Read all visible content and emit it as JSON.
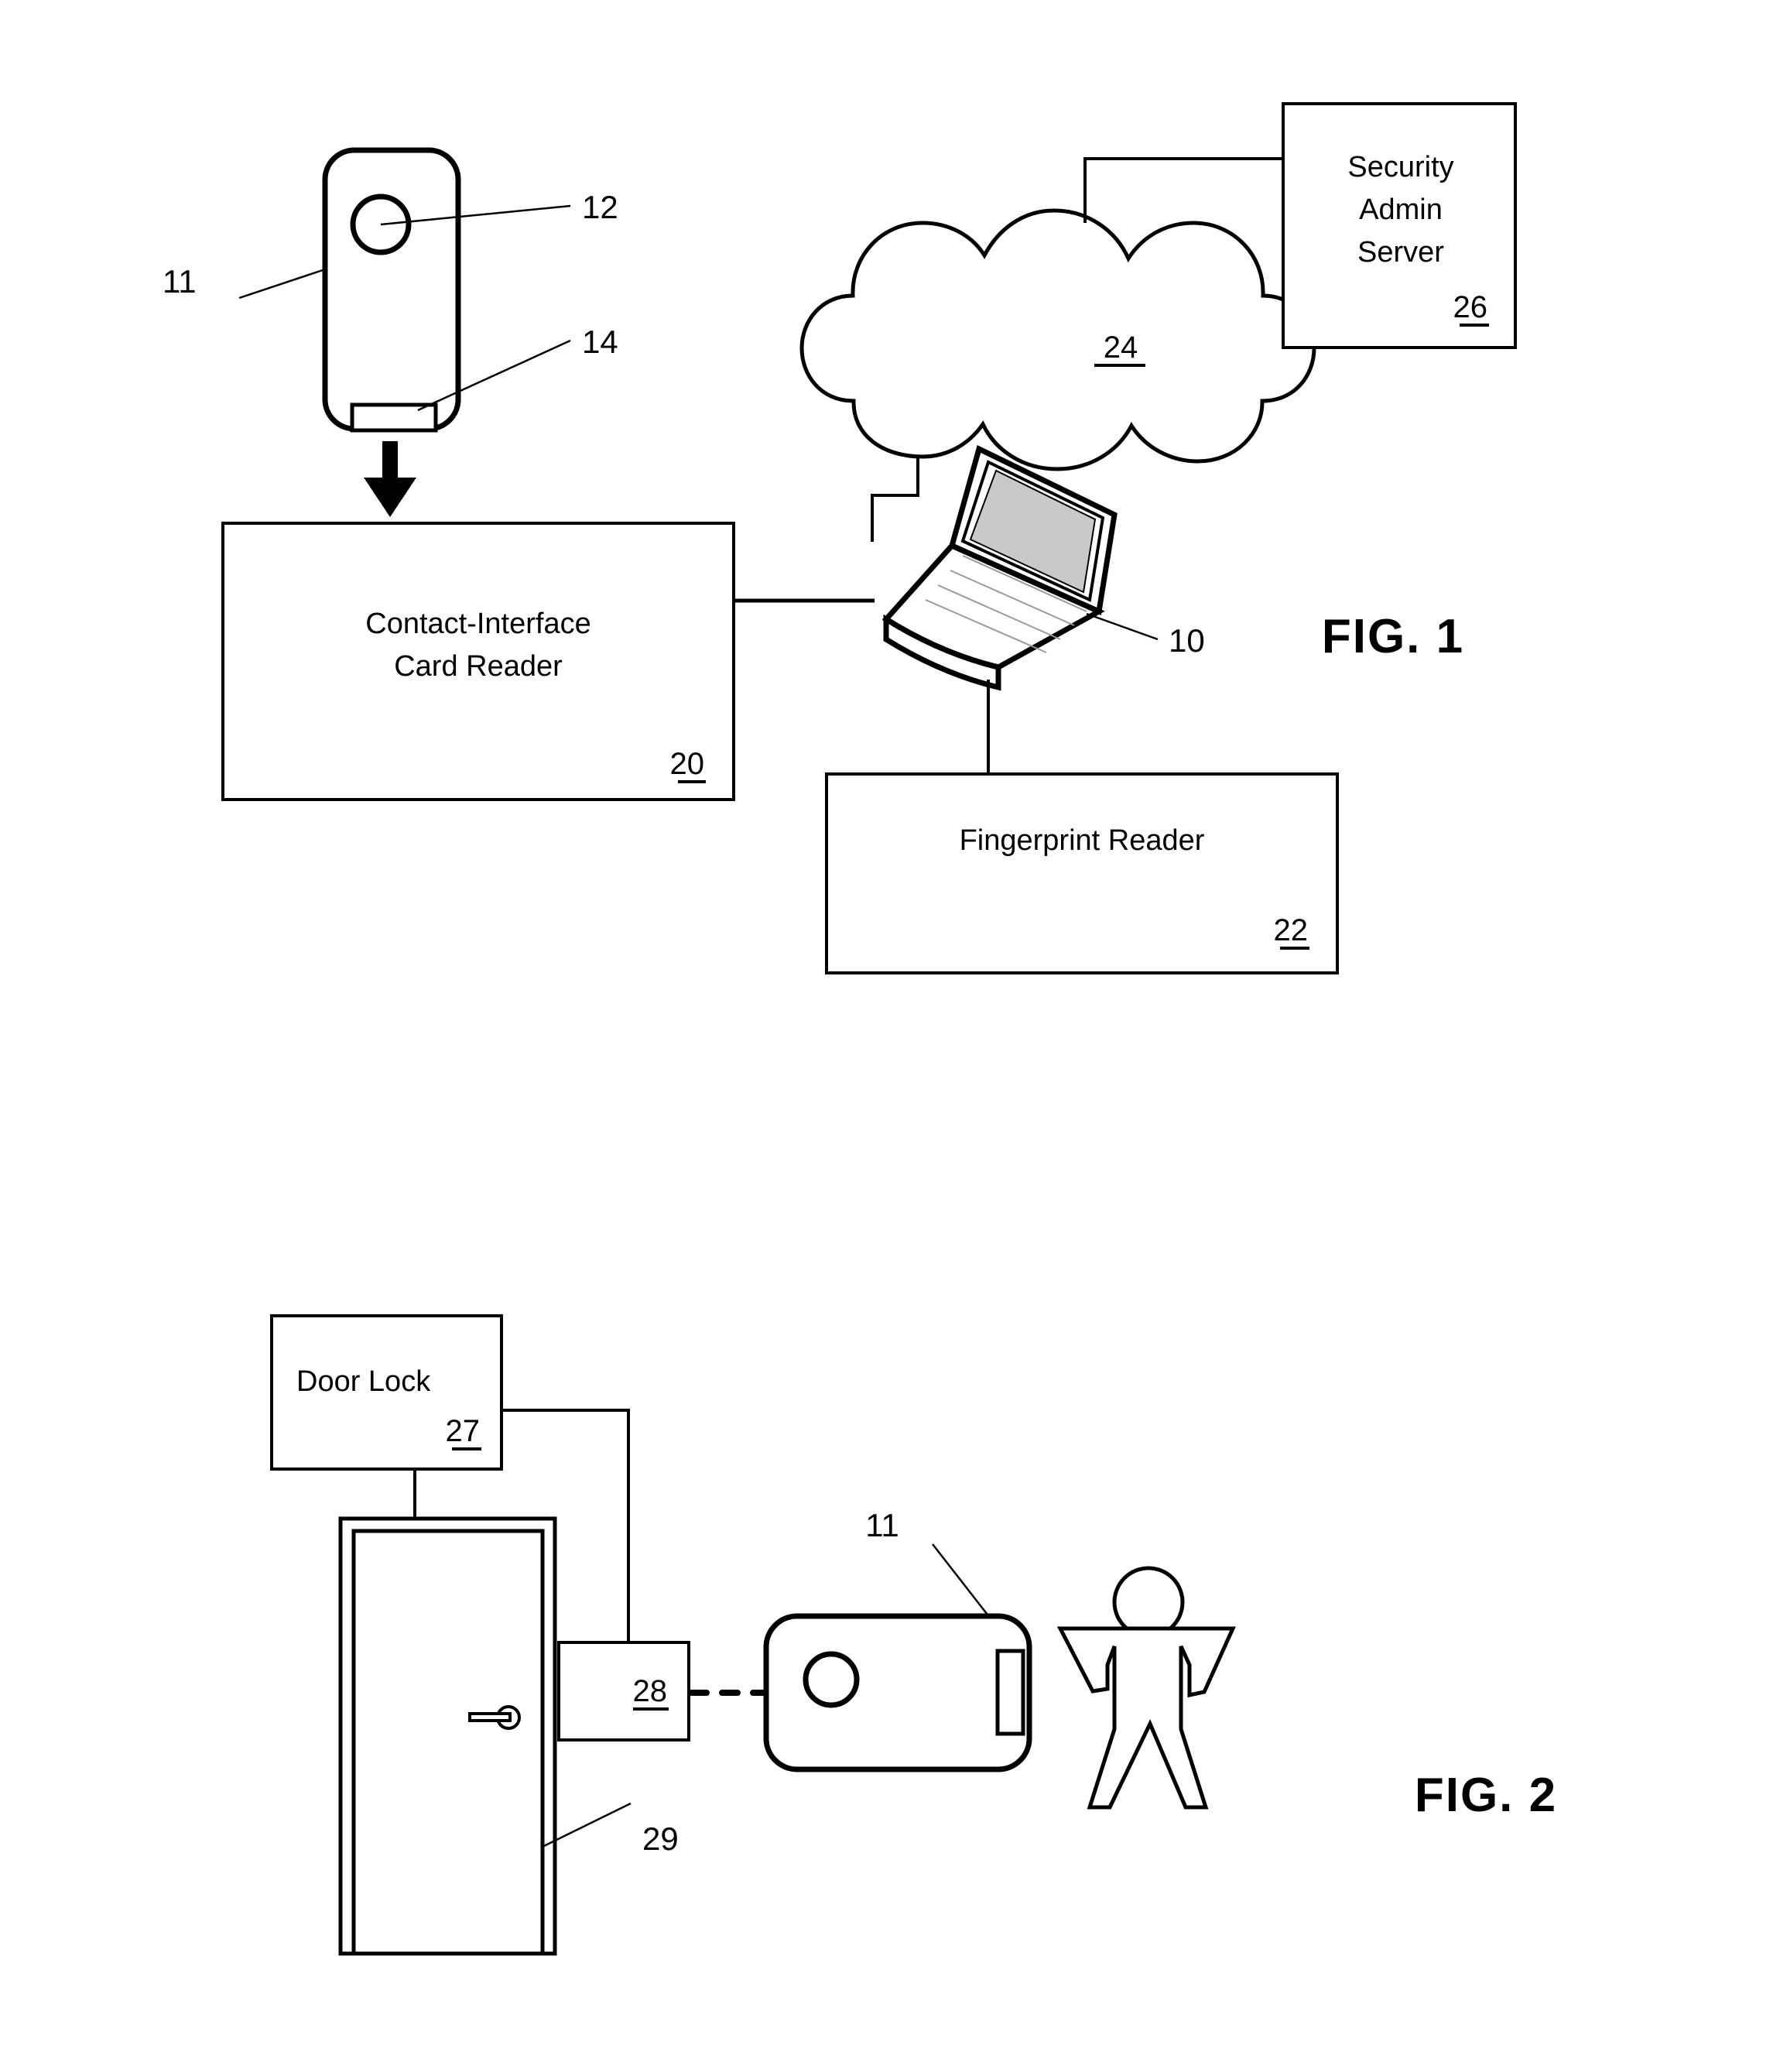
{
  "sheet": {
    "background": "#ffffff",
    "ink": "#000000"
  },
  "figure1": {
    "title": "FIG. 1",
    "card": {
      "ref_device": "11",
      "ref_circle": "12",
      "ref_contact": "14"
    },
    "card_reader": {
      "label_line1": "Contact-Interface",
      "label_line2": "Card Reader",
      "ref": "20"
    },
    "laptop": {
      "ref": "10"
    },
    "cloud": {
      "ref": "24"
    },
    "server": {
      "label_line1": "Security",
      "label_line2": "Admin",
      "label_line3": "Server",
      "ref": "26"
    },
    "fingerprint_reader": {
      "label": "Fingerprint Reader",
      "ref": "22"
    }
  },
  "figure2": {
    "title": "FIG. 2",
    "door_lock": {
      "label": "Door Lock",
      "ref": "27"
    },
    "door": {
      "ref": "29"
    },
    "wall_reader": {
      "ref": "28"
    },
    "card": {
      "ref": "11"
    },
    "person": {
      "ref": ""
    }
  }
}
